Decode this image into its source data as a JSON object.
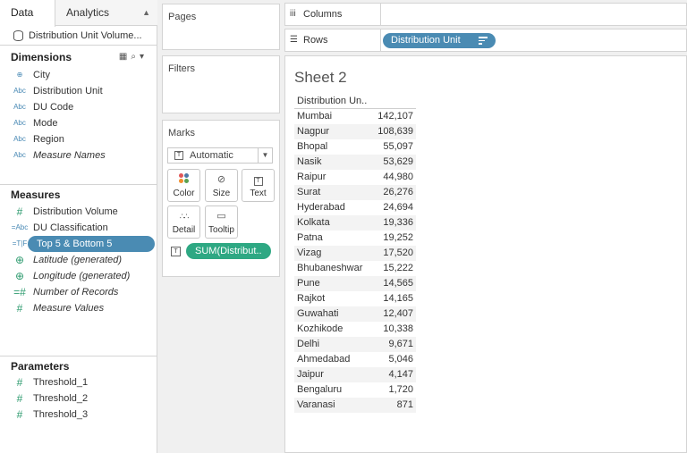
{
  "tabs": {
    "data": "Data",
    "analytics": "Analytics"
  },
  "datasource": "Distribution Unit Volume...",
  "dimensions": {
    "title": "Dimensions",
    "items": [
      {
        "type": "globe",
        "label": "City"
      },
      {
        "type": "Abc",
        "label": "Distribution Unit"
      },
      {
        "type": "Abc",
        "label": "DU Code"
      },
      {
        "type": "Abc",
        "label": "Mode"
      },
      {
        "type": "Abc",
        "label": "Region"
      },
      {
        "type": "Abc",
        "label": "Measure Names",
        "italic": true
      }
    ]
  },
  "measures": {
    "title": "Measures",
    "items": [
      {
        "type": "#",
        "label": "Distribution Volume"
      },
      {
        "type": "=Abc",
        "label": "DU Classification"
      },
      {
        "type": "=T|F",
        "label": "Top 5 & Bottom 5",
        "selected": true
      },
      {
        "type": "globe",
        "label": "Latitude (generated)",
        "italic": true
      },
      {
        "type": "globe",
        "label": "Longitude (generated)",
        "italic": true
      },
      {
        "type": "=#",
        "label": "Number of Records",
        "italic": true
      },
      {
        "type": "#",
        "label": "Measure Values",
        "italic": true
      }
    ]
  },
  "parameters": {
    "title": "Parameters",
    "items": [
      {
        "type": "#",
        "label": "Threshold_1"
      },
      {
        "type": "#",
        "label": "Threshold_2"
      },
      {
        "type": "#",
        "label": "Threshold_3"
      }
    ]
  },
  "panes": {
    "pages": "Pages",
    "filters": "Filters",
    "marks": "Marks"
  },
  "marks": {
    "type": "Automatic",
    "buttons": {
      "color": "Color",
      "size": "Size",
      "text": "Text",
      "detail": "Detail",
      "tooltip": "Tooltip"
    },
    "text_pill": "SUM(Distribut.."
  },
  "shelves": {
    "columns": "Columns",
    "rows": "Rows",
    "row_pill": "Distribution Unit"
  },
  "sheet": {
    "title": "Sheet 2",
    "column_header": "Distribution Un..",
    "rows": [
      {
        "unit": "Mumbai",
        "value": "142,107"
      },
      {
        "unit": "Nagpur",
        "value": "108,639"
      },
      {
        "unit": "Bhopal",
        "value": "55,097"
      },
      {
        "unit": "Nasik",
        "value": "53,629"
      },
      {
        "unit": "Raipur",
        "value": "44,980"
      },
      {
        "unit": "Surat",
        "value": "26,276"
      },
      {
        "unit": "Hyderabad",
        "value": "24,694"
      },
      {
        "unit": "Kolkata",
        "value": "19,336"
      },
      {
        "unit": "Patna",
        "value": "19,252"
      },
      {
        "unit": "Vizag",
        "value": "17,520"
      },
      {
        "unit": "Bhubaneshwar",
        "value": "15,222"
      },
      {
        "unit": "Pune",
        "value": "14,565"
      },
      {
        "unit": "Rajkot",
        "value": "14,165"
      },
      {
        "unit": "Guwahati",
        "value": "12,407"
      },
      {
        "unit": "Kozhikode",
        "value": "10,338"
      },
      {
        "unit": "Delhi",
        "value": "9,671"
      },
      {
        "unit": "Ahmedabad",
        "value": "5,046"
      },
      {
        "unit": "Jaipur",
        "value": "4,147"
      },
      {
        "unit": "Bengaluru",
        "value": "1,720"
      },
      {
        "unit": "Varanasi",
        "value": "871"
      }
    ]
  },
  "colors": {
    "dimension_pill": "#4a8bb3",
    "measure_pill": "#2ea883"
  }
}
